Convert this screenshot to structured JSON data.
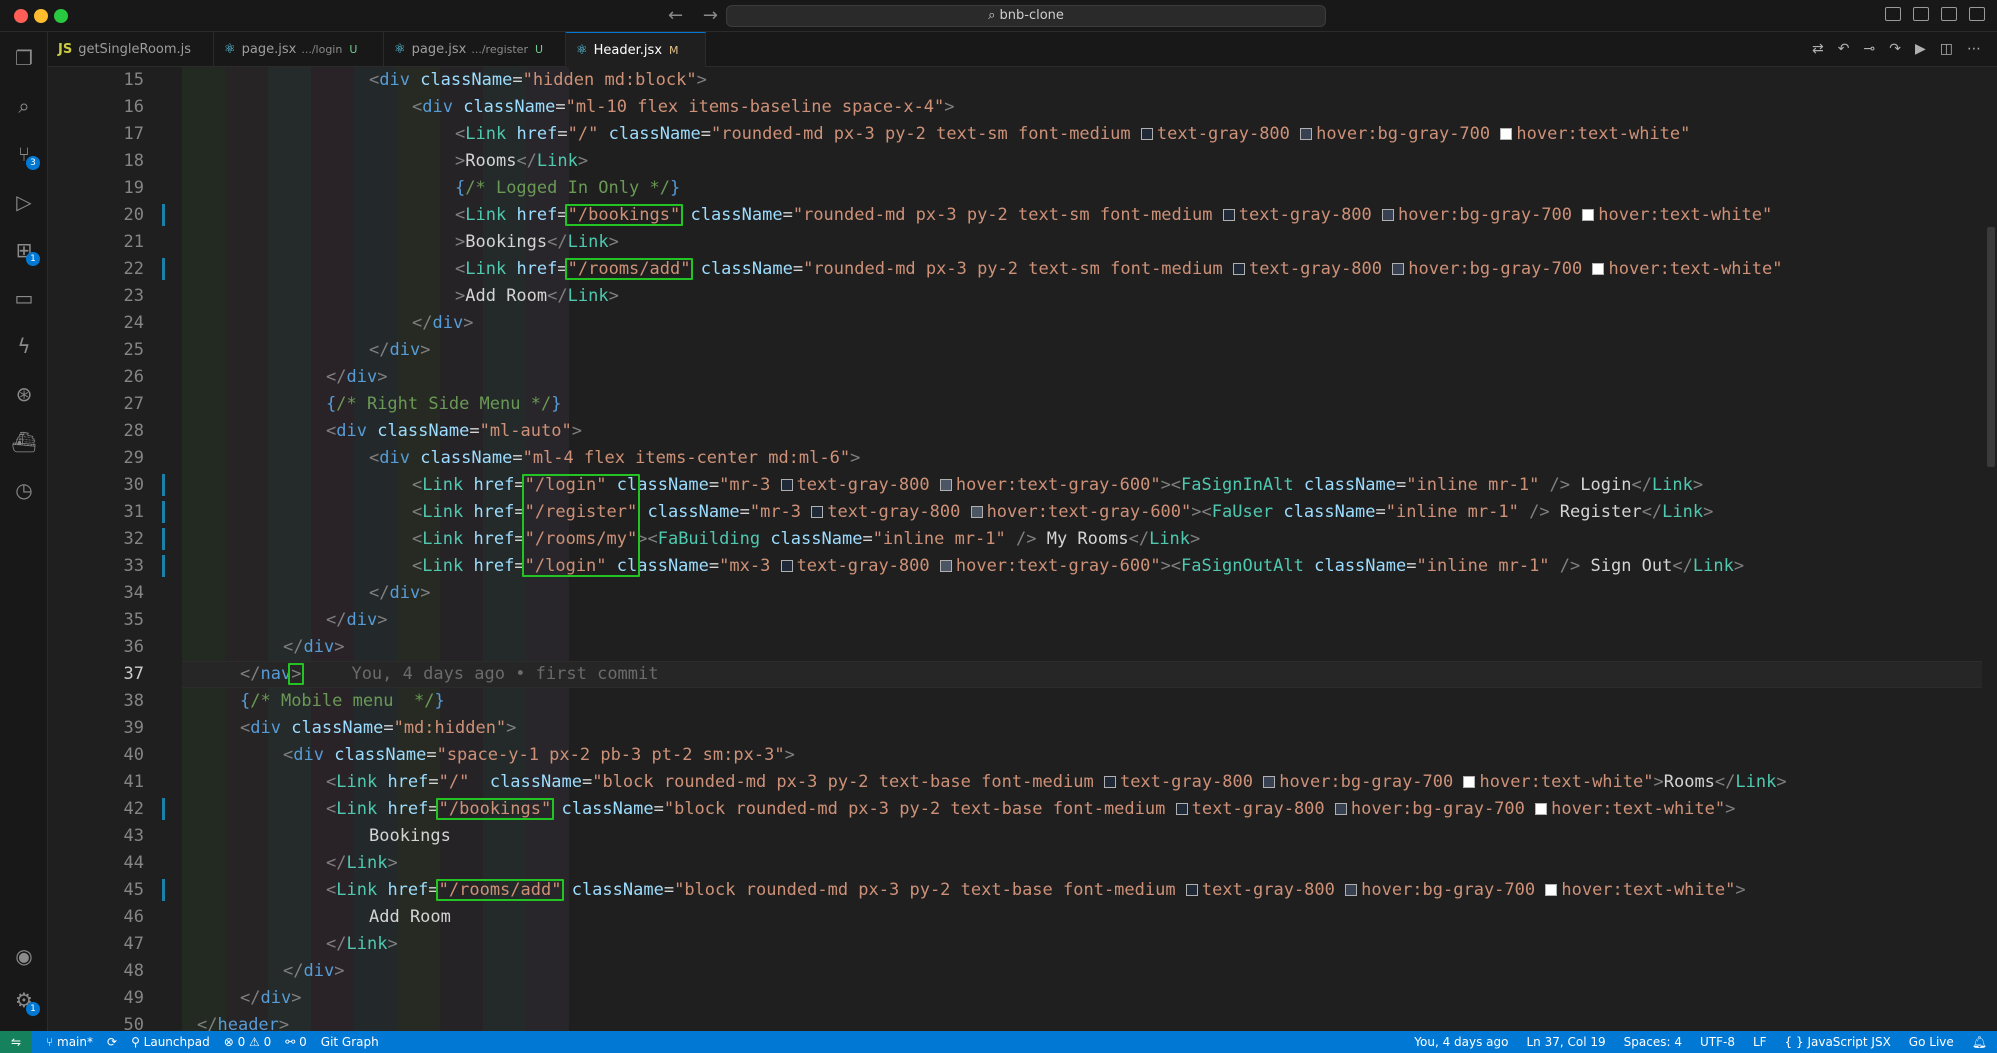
{
  "window": {
    "search_text": "⌕ bnb-clone",
    "back_label": "←",
    "forward_label": "→"
  },
  "tabs": [
    {
      "icon": "JS",
      "label": "getSingleRoom.js",
      "sub": "",
      "status": ""
    },
    {
      "icon": "⚛",
      "label": "page.jsx",
      "sub": ".../login",
      "status": "U"
    },
    {
      "icon": "⚛",
      "label": "page.jsx",
      "sub": ".../register",
      "status": "U"
    },
    {
      "icon": "⚛",
      "label": "Header.jsx",
      "sub": "",
      "status": "M"
    }
  ],
  "activity": {
    "source_control_badge": "3",
    "extensions_badge": "1",
    "manage_badge": "1"
  },
  "editor": {
    "blame_text": "You, 4 days ago • first commit"
  },
  "lines": [
    {
      "n": "15",
      "tokens": [
        [
          "t-br",
          "<"
        ],
        [
          "t-tag",
          "div"
        ],
        [
          "t-attr",
          " className"
        ],
        [
          "t-txt",
          "="
        ],
        [
          "t-str",
          "\"hidden md:block\""
        ],
        [
          "t-br",
          ">"
        ]
      ]
    },
    {
      "n": "16",
      "tokens": [
        [
          "t-br",
          "<"
        ],
        [
          "t-tag",
          "div"
        ],
        [
          "t-attr",
          " className"
        ],
        [
          "t-txt",
          "="
        ],
        [
          "t-str",
          "\"ml-10 flex items-baseline space-x-4\""
        ],
        [
          "t-br",
          ">"
        ]
      ]
    },
    {
      "n": "17",
      "tokens": [
        [
          "t-br",
          "<"
        ],
        [
          "t-comp",
          "Link"
        ],
        [
          "t-attr",
          " href"
        ],
        [
          "t-txt",
          "="
        ],
        [
          "t-str",
          "\"/\""
        ],
        [
          "t-attr",
          " className"
        ],
        [
          "t-txt",
          "="
        ],
        [
          "t-str",
          "\"rounded-md px-3 py-2 text-sm font-medium "
        ],
        [
          "sq g800",
          ""
        ],
        [
          "t-str",
          "text-gray-800 "
        ],
        [
          "sq g700",
          ""
        ],
        [
          "t-str",
          "hover:bg-gray-700 "
        ],
        [
          "sq white",
          ""
        ],
        [
          "t-str",
          "hover:text-white\""
        ]
      ]
    },
    {
      "n": "18",
      "tokens": [
        [
          "t-br",
          ">"
        ],
        [
          "t-txt",
          "Rooms"
        ],
        [
          "t-br",
          "</"
        ],
        [
          "t-comp",
          "Link"
        ],
        [
          "t-br",
          ">"
        ]
      ]
    },
    {
      "n": "19",
      "tokens": [
        [
          "t-brace",
          "{"
        ],
        [
          "t-cmt",
          "/* Logged In Only */"
        ],
        [
          "t-brace",
          "}"
        ]
      ]
    },
    {
      "n": "20",
      "tokens": [
        [
          "t-br",
          "<"
        ],
        [
          "t-comp",
          "Link"
        ],
        [
          "t-attr",
          " href"
        ],
        [
          "t-txt",
          "="
        ],
        [
          "t-str",
          "\"/bookings\""
        ],
        [
          "t-attr",
          " className"
        ],
        [
          "t-txt",
          "="
        ],
        [
          "t-str",
          "\"rounded-md px-3 py-2 text-sm font-medium "
        ],
        [
          "sq g800",
          ""
        ],
        [
          "t-str",
          "text-gray-800 "
        ],
        [
          "sq g700",
          ""
        ],
        [
          "t-str",
          "hover:bg-gray-700 "
        ],
        [
          "sq white",
          ""
        ],
        [
          "t-str",
          "hover:text-white\""
        ]
      ]
    },
    {
      "n": "21",
      "tokens": [
        [
          "t-br",
          ">"
        ],
        [
          "t-txt",
          "Bookings"
        ],
        [
          "t-br",
          "</"
        ],
        [
          "t-comp",
          "Link"
        ],
        [
          "t-br",
          ">"
        ]
      ]
    },
    {
      "n": "22",
      "tokens": [
        [
          "t-br",
          "<"
        ],
        [
          "t-comp",
          "Link"
        ],
        [
          "t-attr",
          " href"
        ],
        [
          "t-txt",
          "="
        ],
        [
          "t-str",
          "\"/rooms/add\""
        ],
        [
          "t-attr",
          " className"
        ],
        [
          "t-txt",
          "="
        ],
        [
          "t-str",
          "\"rounded-md px-3 py-2 text-sm font-medium "
        ],
        [
          "sq g800",
          ""
        ],
        [
          "t-str",
          "text-gray-800 "
        ],
        [
          "sq g700",
          ""
        ],
        [
          "t-str",
          "hover:bg-gray-700 "
        ],
        [
          "sq white",
          ""
        ],
        [
          "t-str",
          "hover:text-white\""
        ]
      ]
    },
    {
      "n": "23",
      "tokens": [
        [
          "t-br",
          ">"
        ],
        [
          "t-txt",
          "Add Room"
        ],
        [
          "t-br",
          "</"
        ],
        [
          "t-comp",
          "Link"
        ],
        [
          "t-br",
          ">"
        ]
      ]
    },
    {
      "n": "24",
      "tokens": [
        [
          "t-br",
          "</"
        ],
        [
          "t-tag",
          "div"
        ],
        [
          "t-br",
          ">"
        ]
      ]
    },
    {
      "n": "25",
      "tokens": [
        [
          "t-br",
          "</"
        ],
        [
          "t-tag",
          "div"
        ],
        [
          "t-br",
          ">"
        ]
      ]
    },
    {
      "n": "26",
      "tokens": [
        [
          "t-br",
          "</"
        ],
        [
          "t-tag",
          "div"
        ],
        [
          "t-br",
          ">"
        ]
      ]
    },
    {
      "n": "27",
      "tokens": [
        [
          "t-brace",
          "{"
        ],
        [
          "t-cmt",
          "/* Right Side Menu */"
        ],
        [
          "t-brace",
          "}"
        ]
      ]
    },
    {
      "n": "28",
      "tokens": [
        [
          "t-br",
          "<"
        ],
        [
          "t-tag",
          "div"
        ],
        [
          "t-attr",
          " className"
        ],
        [
          "t-txt",
          "="
        ],
        [
          "t-str",
          "\"ml-auto\""
        ],
        [
          "t-br",
          ">"
        ]
      ]
    },
    {
      "n": "29",
      "tokens": [
        [
          "t-br",
          "<"
        ],
        [
          "t-tag",
          "div"
        ],
        [
          "t-attr",
          " className"
        ],
        [
          "t-txt",
          "="
        ],
        [
          "t-str",
          "\"ml-4 flex items-center md:ml-6\""
        ],
        [
          "t-br",
          ">"
        ]
      ]
    },
    {
      "n": "30",
      "tokens": [
        [
          "t-br",
          "<"
        ],
        [
          "t-comp",
          "Link"
        ],
        [
          "t-attr",
          " href"
        ],
        [
          "t-txt",
          "="
        ],
        [
          "t-str",
          "\"/login\""
        ],
        [
          "t-attr",
          " className"
        ],
        [
          "t-txt",
          "="
        ],
        [
          "t-str",
          "\"mr-3 "
        ],
        [
          "sq g800",
          ""
        ],
        [
          "t-str",
          "text-gray-800 "
        ],
        [
          "sq g600",
          ""
        ],
        [
          "t-str",
          "hover:text-gray-600\""
        ],
        [
          "t-br",
          "><"
        ],
        [
          "t-comp",
          "FaSignInAlt"
        ],
        [
          "t-attr",
          " className"
        ],
        [
          "t-txt",
          "="
        ],
        [
          "t-str",
          "\"inline mr-1\""
        ],
        [
          "t-br",
          " /> "
        ],
        [
          "t-txt",
          "Login"
        ],
        [
          "t-br",
          "</"
        ],
        [
          "t-comp",
          "Link"
        ],
        [
          "t-br",
          ">"
        ]
      ]
    },
    {
      "n": "31",
      "tokens": [
        [
          "t-br",
          "<"
        ],
        [
          "t-comp",
          "Link"
        ],
        [
          "t-attr",
          " href"
        ],
        [
          "t-txt",
          "="
        ],
        [
          "t-str",
          "\"/register\""
        ],
        [
          "t-attr",
          " className"
        ],
        [
          "t-txt",
          "="
        ],
        [
          "t-str",
          "\"mr-3 "
        ],
        [
          "sq g800",
          ""
        ],
        [
          "t-str",
          "text-gray-800 "
        ],
        [
          "sq g600",
          ""
        ],
        [
          "t-str",
          "hover:text-gray-600\""
        ],
        [
          "t-br",
          "><"
        ],
        [
          "t-comp",
          "FaUser"
        ],
        [
          "t-attr",
          " className"
        ],
        [
          "t-txt",
          "="
        ],
        [
          "t-str",
          "\"inline mr-1\""
        ],
        [
          "t-br",
          " /> "
        ],
        [
          "t-txt",
          "Register"
        ],
        [
          "t-br",
          "</"
        ],
        [
          "t-comp",
          "Link"
        ],
        [
          "t-br",
          ">"
        ]
      ]
    },
    {
      "n": "32",
      "tokens": [
        [
          "t-br",
          "<"
        ],
        [
          "t-comp",
          "Link"
        ],
        [
          "t-attr",
          " href"
        ],
        [
          "t-txt",
          "="
        ],
        [
          "t-str",
          "\"/rooms/my\""
        ],
        [
          "t-br",
          "><"
        ],
        [
          "t-comp",
          "FaBuilding"
        ],
        [
          "t-attr",
          " className"
        ],
        [
          "t-txt",
          "="
        ],
        [
          "t-str",
          "\"inline mr-1\""
        ],
        [
          "t-br",
          " /> "
        ],
        [
          "t-txt",
          "My Rooms"
        ],
        [
          "t-br",
          "</"
        ],
        [
          "t-comp",
          "Link"
        ],
        [
          "t-br",
          ">"
        ]
      ]
    },
    {
      "n": "33",
      "tokens": [
        [
          "t-br",
          "<"
        ],
        [
          "t-comp",
          "Link"
        ],
        [
          "t-attr",
          " href"
        ],
        [
          "t-txt",
          "="
        ],
        [
          "t-str",
          "\"/login\""
        ],
        [
          "t-attr",
          " className"
        ],
        [
          "t-txt",
          "="
        ],
        [
          "t-str",
          "\"mx-3 "
        ],
        [
          "sq g800",
          ""
        ],
        [
          "t-str",
          "text-gray-800 "
        ],
        [
          "sq g600",
          ""
        ],
        [
          "t-str",
          "hover:text-gray-600\""
        ],
        [
          "t-br",
          "><"
        ],
        [
          "t-comp",
          "FaSignOutAlt"
        ],
        [
          "t-attr",
          " className"
        ],
        [
          "t-txt",
          "="
        ],
        [
          "t-str",
          "\"inline mr-1\""
        ],
        [
          "t-br",
          " /> "
        ],
        [
          "t-txt",
          "Sign Out"
        ],
        [
          "t-br",
          "</"
        ],
        [
          "t-comp",
          "Link"
        ],
        [
          "t-br",
          ">"
        ]
      ]
    },
    {
      "n": "34",
      "tokens": [
        [
          "t-br",
          "</"
        ],
        [
          "t-tag",
          "div"
        ],
        [
          "t-br",
          ">"
        ]
      ]
    },
    {
      "n": "35",
      "tokens": [
        [
          "t-br",
          "</"
        ],
        [
          "t-tag",
          "div"
        ],
        [
          "t-br",
          ">"
        ]
      ]
    },
    {
      "n": "36",
      "tokens": [
        [
          "t-br",
          "</"
        ],
        [
          "t-tag",
          "div"
        ],
        [
          "t-br",
          ">"
        ]
      ]
    },
    {
      "n": "37",
      "tokens": [
        [
          "t-br",
          "</"
        ],
        [
          "t-tag",
          "nav"
        ],
        [
          "t-br",
          ">"
        ]
      ]
    },
    {
      "n": "38",
      "tokens": [
        [
          "t-brace",
          "{"
        ],
        [
          "t-cmt",
          "/* Mobile menu  */"
        ],
        [
          "t-brace",
          "}"
        ]
      ]
    },
    {
      "n": "39",
      "tokens": [
        [
          "t-br",
          "<"
        ],
        [
          "t-tag",
          "div"
        ],
        [
          "t-attr",
          " className"
        ],
        [
          "t-txt",
          "="
        ],
        [
          "t-str",
          "\"md:hidden\""
        ],
        [
          "t-br",
          ">"
        ]
      ]
    },
    {
      "n": "40",
      "tokens": [
        [
          "t-br",
          "<"
        ],
        [
          "t-tag",
          "div"
        ],
        [
          "t-attr",
          " className"
        ],
        [
          "t-txt",
          "="
        ],
        [
          "t-str",
          "\"space-y-1 px-2 pb-3 pt-2 sm:px-3\""
        ],
        [
          "t-br",
          ">"
        ]
      ]
    },
    {
      "n": "41",
      "tokens": [
        [
          "t-br",
          "<"
        ],
        [
          "t-comp",
          "Link"
        ],
        [
          "t-attr",
          " href"
        ],
        [
          "t-txt",
          "="
        ],
        [
          "t-str",
          "\"/\""
        ],
        [
          "t-attr",
          "  className"
        ],
        [
          "t-txt",
          "="
        ],
        [
          "t-str",
          "\"block rounded-md px-3 py-2 text-base font-medium "
        ],
        [
          "sq g800",
          ""
        ],
        [
          "t-str",
          "text-gray-800 "
        ],
        [
          "sq g700",
          ""
        ],
        [
          "t-str",
          "hover:bg-gray-700 "
        ],
        [
          "sq white",
          ""
        ],
        [
          "t-str",
          "hover:text-white\""
        ],
        [
          "t-br",
          ">"
        ],
        [
          "t-txt",
          "Rooms"
        ],
        [
          "t-br",
          "</"
        ],
        [
          "t-comp",
          "Link"
        ],
        [
          "t-br",
          ">"
        ]
      ]
    },
    {
      "n": "42",
      "tokens": [
        [
          "t-br",
          "<"
        ],
        [
          "t-comp",
          "Link"
        ],
        [
          "t-attr",
          " href"
        ],
        [
          "t-txt",
          "="
        ],
        [
          "t-str",
          "\"/bookings\""
        ],
        [
          "t-attr",
          " className"
        ],
        [
          "t-txt",
          "="
        ],
        [
          "t-str",
          "\"block rounded-md px-3 py-2 text-base font-medium "
        ],
        [
          "sq g800",
          ""
        ],
        [
          "t-str",
          "text-gray-800 "
        ],
        [
          "sq g700",
          ""
        ],
        [
          "t-str",
          "hover:bg-gray-700 "
        ],
        [
          "sq white",
          ""
        ],
        [
          "t-str",
          "hover:text-white\""
        ],
        [
          "t-br",
          ">"
        ]
      ]
    },
    {
      "n": "43",
      "tokens": [
        [
          "t-txt",
          "Bookings"
        ]
      ]
    },
    {
      "n": "44",
      "tokens": [
        [
          "t-br",
          "</"
        ],
        [
          "t-comp",
          "Link"
        ],
        [
          "t-br",
          ">"
        ]
      ]
    },
    {
      "n": "45",
      "tokens": [
        [
          "t-br",
          "<"
        ],
        [
          "t-comp",
          "Link"
        ],
        [
          "t-attr",
          " href"
        ],
        [
          "t-txt",
          "="
        ],
        [
          "t-str",
          "\"/rooms/add\""
        ],
        [
          "t-attr",
          " className"
        ],
        [
          "t-txt",
          "="
        ],
        [
          "t-str",
          "\"block rounded-md px-3 py-2 text-base font-medium "
        ],
        [
          "sq g800",
          ""
        ],
        [
          "t-str",
          "text-gray-800 "
        ],
        [
          "sq g700",
          ""
        ],
        [
          "t-str",
          "hover:bg-gray-700 "
        ],
        [
          "sq white",
          ""
        ],
        [
          "t-str",
          "hover:text-white\""
        ],
        [
          "t-br",
          ">"
        ]
      ]
    },
    {
      "n": "46",
      "tokens": [
        [
          "t-txt",
          "Add Room"
        ]
      ]
    },
    {
      "n": "47",
      "tokens": [
        [
          "t-br",
          "</"
        ],
        [
          "t-comp",
          "Link"
        ],
        [
          "t-br",
          ">"
        ]
      ]
    },
    {
      "n": "48",
      "tokens": [
        [
          "t-br",
          "</"
        ],
        [
          "t-tag",
          "div"
        ],
        [
          "t-br",
          ">"
        ]
      ]
    },
    {
      "n": "49",
      "tokens": [
        [
          "t-br",
          "</"
        ],
        [
          "t-tag",
          "div"
        ],
        [
          "t-br",
          ">"
        ]
      ]
    },
    {
      "n": "50",
      "tokens": [
        [
          "t-br",
          "</"
        ],
        [
          "t-tag",
          "header"
        ],
        [
          "t-br",
          ">"
        ]
      ]
    }
  ],
  "statusbar": {
    "branch": "⑂ main*",
    "sync": "⟳",
    "launchpad": "⚲ Launchpad",
    "problems": "⊗ 0 ⚠ 0",
    "ports": "⚯ 0",
    "git_graph": "Git Graph",
    "blame": "You, 4 days ago",
    "position": "Ln 37, Col 19",
    "spaces": "Spaces: 4",
    "encoding": "UTF-8",
    "eol": "LF",
    "language": "{ } JavaScript JSX",
    "golive": "Go Live",
    "colors": {
      "bar": "#0078d4",
      "remote": "#16825d",
      "highlight_box": "#22c322"
    }
  }
}
